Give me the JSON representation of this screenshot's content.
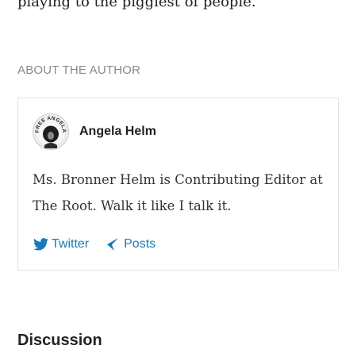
{
  "article": {
    "trailing_text": "playing to the piggiest of people."
  },
  "about_author": {
    "section_label": "ABOUT THE AUTHOR",
    "name": "Angela Helm",
    "avatar": {
      "icon": "free-angela-button-avatar",
      "button_text": "FREE ANGELA"
    },
    "bio": "Ms. Bronner Helm is Contributing Editor at The Root. Walk it like I talk it.",
    "links": [
      {
        "label": "Twitter",
        "icon": "twitter-bird-icon"
      },
      {
        "label": "Posts",
        "icon": "kinja-posts-icon"
      }
    ]
  },
  "discussion": {
    "heading": "Discussion"
  },
  "colors": {
    "link": "#1a7ab8",
    "muted_label": "#8a8a8a",
    "text": "#222222",
    "card_border": "#e2e2e2"
  }
}
